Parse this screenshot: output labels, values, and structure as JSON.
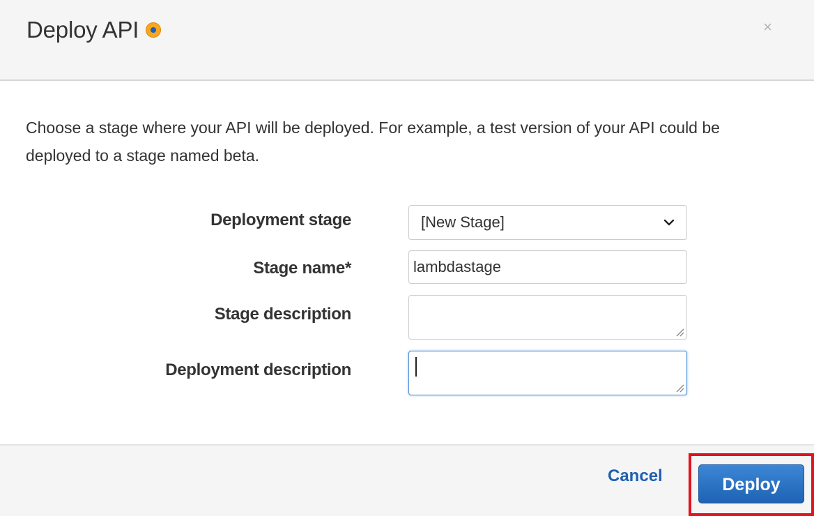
{
  "dialog": {
    "title": "Deploy API",
    "close_symbol": "×",
    "description": "Choose a stage where your API will be deployed. For example, a test version of your API could be deployed to a stage named beta."
  },
  "form": {
    "deployment_stage": {
      "label": "Deployment stage",
      "selected": "[New Stage]"
    },
    "stage_name": {
      "label": "Stage name*",
      "value": "lambdastage"
    },
    "stage_description": {
      "label": "Stage description",
      "value": ""
    },
    "deployment_description": {
      "label": "Deployment description",
      "value": ""
    }
  },
  "footer": {
    "cancel_label": "Cancel",
    "deploy_label": "Deploy"
  },
  "colors": {
    "status_dot": "#f5a623",
    "status_dot_center": "#1f5fb8",
    "cancel_link": "#1f5fb0",
    "deploy_button": "#1e62b4",
    "highlight": "#e0141e"
  },
  "icons": {
    "status": "status-dot-icon",
    "close": "close-icon",
    "select_arrow": "chevron-down-icon",
    "resize": "resize-grip-icon"
  }
}
